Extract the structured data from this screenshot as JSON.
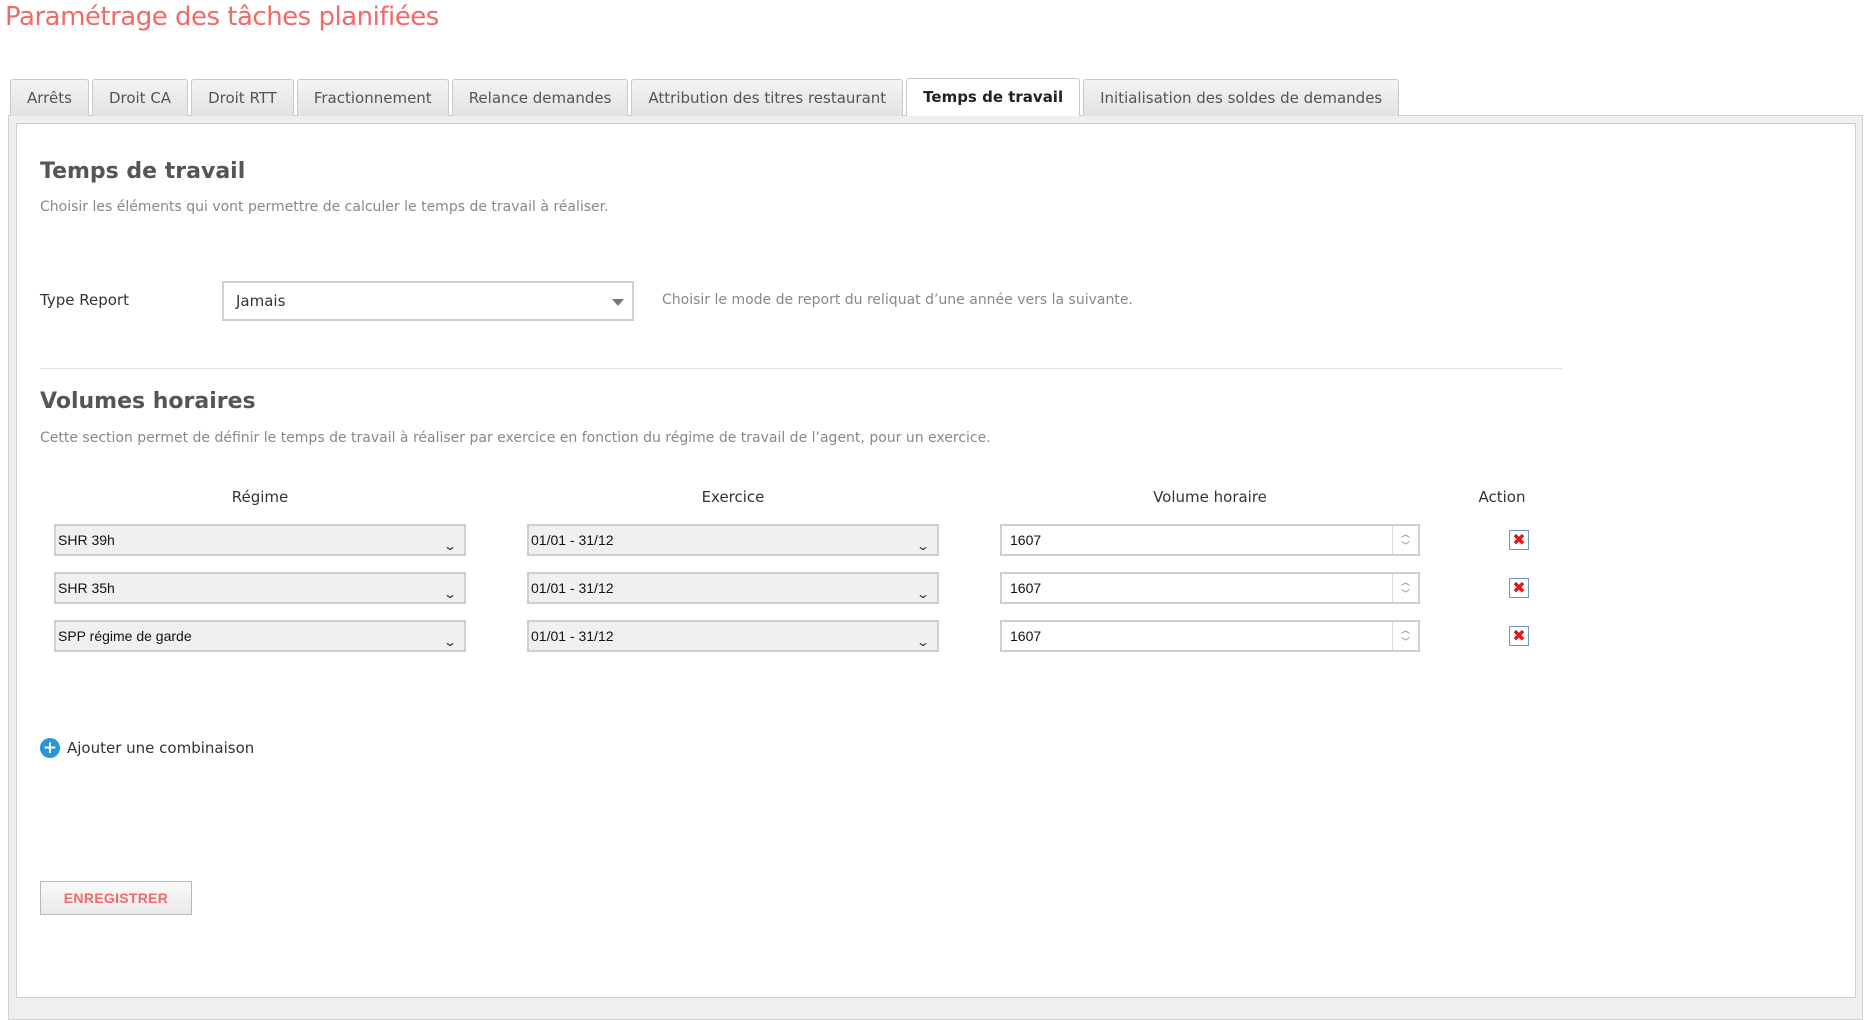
{
  "page": {
    "title": "Paramétrage des tâches planifiées"
  },
  "tabs": [
    {
      "label": "Arrêts",
      "active": false
    },
    {
      "label": "Droit CA",
      "active": false
    },
    {
      "label": "Droit RTT",
      "active": false
    },
    {
      "label": "Fractionnement",
      "active": false
    },
    {
      "label": "Relance demandes",
      "active": false
    },
    {
      "label": "Attribution des titres restaurant",
      "active": false
    },
    {
      "label": "Temps de travail",
      "active": true
    },
    {
      "label": "Initialisation des soldes de demandes",
      "active": false
    }
  ],
  "temps_travail": {
    "title": "Temps de travail",
    "description": "Choisir les éléments qui vont permettre de calculer le temps de travail à réaliser.",
    "type_report": {
      "label": "Type Report",
      "value": "Jamais",
      "help": "Choisir le mode de report du reliquat d’une année vers la suivante."
    }
  },
  "volumes": {
    "title": "Volumes horaires",
    "description": "Cette section permet de définir le temps de travail à réaliser par exercice en fonction du régime de travail de l’agent, pour un exercice.",
    "columns": {
      "regime": "Régime",
      "exercice": "Exercice",
      "volume": "Volume horaire",
      "action": "Action"
    },
    "rows": [
      {
        "regime": "SHR 39h",
        "exercice": "01/01 - 31/12",
        "volume": "1607"
      },
      {
        "regime": "SHR 35h",
        "exercice": "01/01 - 31/12",
        "volume": "1607"
      },
      {
        "regime": "SPP régime de garde",
        "exercice": "01/01 - 31/12",
        "volume": "1607"
      }
    ],
    "add_label": "Ajouter une combinaison"
  },
  "actions": {
    "save_label": "ENREGISTRER"
  },
  "colors": {
    "accent": "#f06a68",
    "add_icon": "#2996d8",
    "delete_icon": "#e01b1b"
  },
  "icons": {
    "select_caret": "caret-down-icon",
    "row_chevron": "chevron-down-icon",
    "spinner": "spinner-arrows-icon",
    "delete": "delete-icon",
    "add": "plus-circle-icon"
  }
}
